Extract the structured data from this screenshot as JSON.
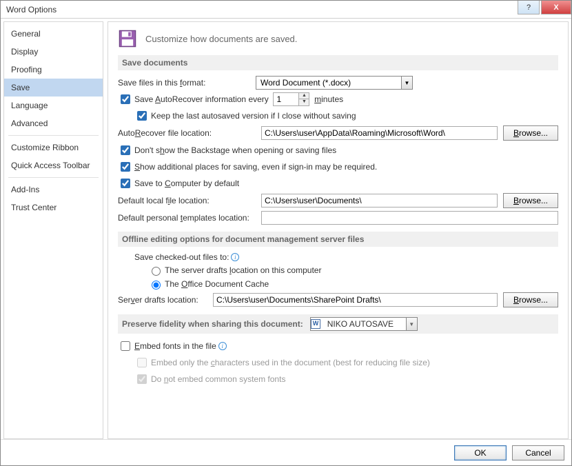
{
  "window": {
    "title": "Word Options"
  },
  "winbtns": {
    "help": "?",
    "close": "X"
  },
  "sidebar": {
    "items": [
      {
        "label": "General"
      },
      {
        "label": "Display"
      },
      {
        "label": "Proofing"
      },
      {
        "label": "Save",
        "selected": true
      },
      {
        "label": "Language"
      },
      {
        "label": "Advanced"
      }
    ],
    "items2": [
      {
        "label": "Customize Ribbon"
      },
      {
        "label": "Quick Access Toolbar"
      }
    ],
    "items3": [
      {
        "label": "Add-Ins"
      },
      {
        "label": "Trust Center"
      }
    ]
  },
  "header": {
    "desc": "Customize how documents are saved."
  },
  "sec_save": {
    "title": "Save documents",
    "format_label_pre": "Save files in this ",
    "format_label_u": "f",
    "format_label_post": "ormat:",
    "format_value": "Word Document (*.docx)",
    "autorecover_pre": "Save ",
    "autorecover_u": "A",
    "autorecover_post": "utoRecover information every",
    "autorecover_value": "1",
    "minutes_u": "m",
    "minutes_post": "inutes",
    "keep_last": "Keep the last autosaved version if I close without saving",
    "ar_loc_pre": "Auto",
    "ar_loc_u": "R",
    "ar_loc_post": "ecover file location:",
    "ar_loc_value": "C:\\Users\\user\\AppData\\Roaming\\Microsoft\\Word\\",
    "browse_b": "B",
    "browse_rest": "rowse...",
    "dont_show_pre": "Don't s",
    "dont_show_u": "h",
    "dont_show_post": "ow the Backstage when opening or saving files",
    "show_additional_pre": "",
    "show_additional_u": "S",
    "show_additional_post": "how additional places for saving, even if sign-in may be required.",
    "save_computer_pre": "Save to ",
    "save_computer_u": "C",
    "save_computer_post": "omputer by default",
    "default_local_pre": "Default local f",
    "default_local_u": "i",
    "default_local_post": "le location:",
    "default_local_value": "C:\\Users\\user\\Documents\\",
    "default_tmpl_pre": "Default personal ",
    "default_tmpl_u": "t",
    "default_tmpl_post": "emplates location:",
    "default_tmpl_value": ""
  },
  "sec_offline": {
    "title": "Offline editing options for document management server files",
    "save_checked_out": "Save checked-out files to:",
    "radio1_pre": "The server drafts ",
    "radio1_u": "l",
    "radio1_post": "ocation on this computer",
    "radio2_pre": "The ",
    "radio2_u": "O",
    "radio2_post": "ffice Document Cache",
    "srv_loc_pre": "Ser",
    "srv_loc_u": "v",
    "srv_loc_post": "er drafts location:",
    "srv_loc_value": "C:\\Users\\user\\Documents\\SharePoint Drafts\\"
  },
  "sec_preserve": {
    "title": "Preserve fidelity when sharing this document:",
    "doc_value": "NIKO AUTOSAVE",
    "embed_pre": "",
    "embed_u": "E",
    "embed_post": "mbed fonts in the file",
    "embed_only_pre": "Embed only the ",
    "embed_only_u": "c",
    "embed_only_post": "haracters used in the document (best for reducing file size)",
    "noembed_pre": "Do ",
    "noembed_u": "n",
    "noembed_post": "ot embed common system fonts"
  },
  "footer": {
    "ok": "OK",
    "cancel": "Cancel"
  }
}
